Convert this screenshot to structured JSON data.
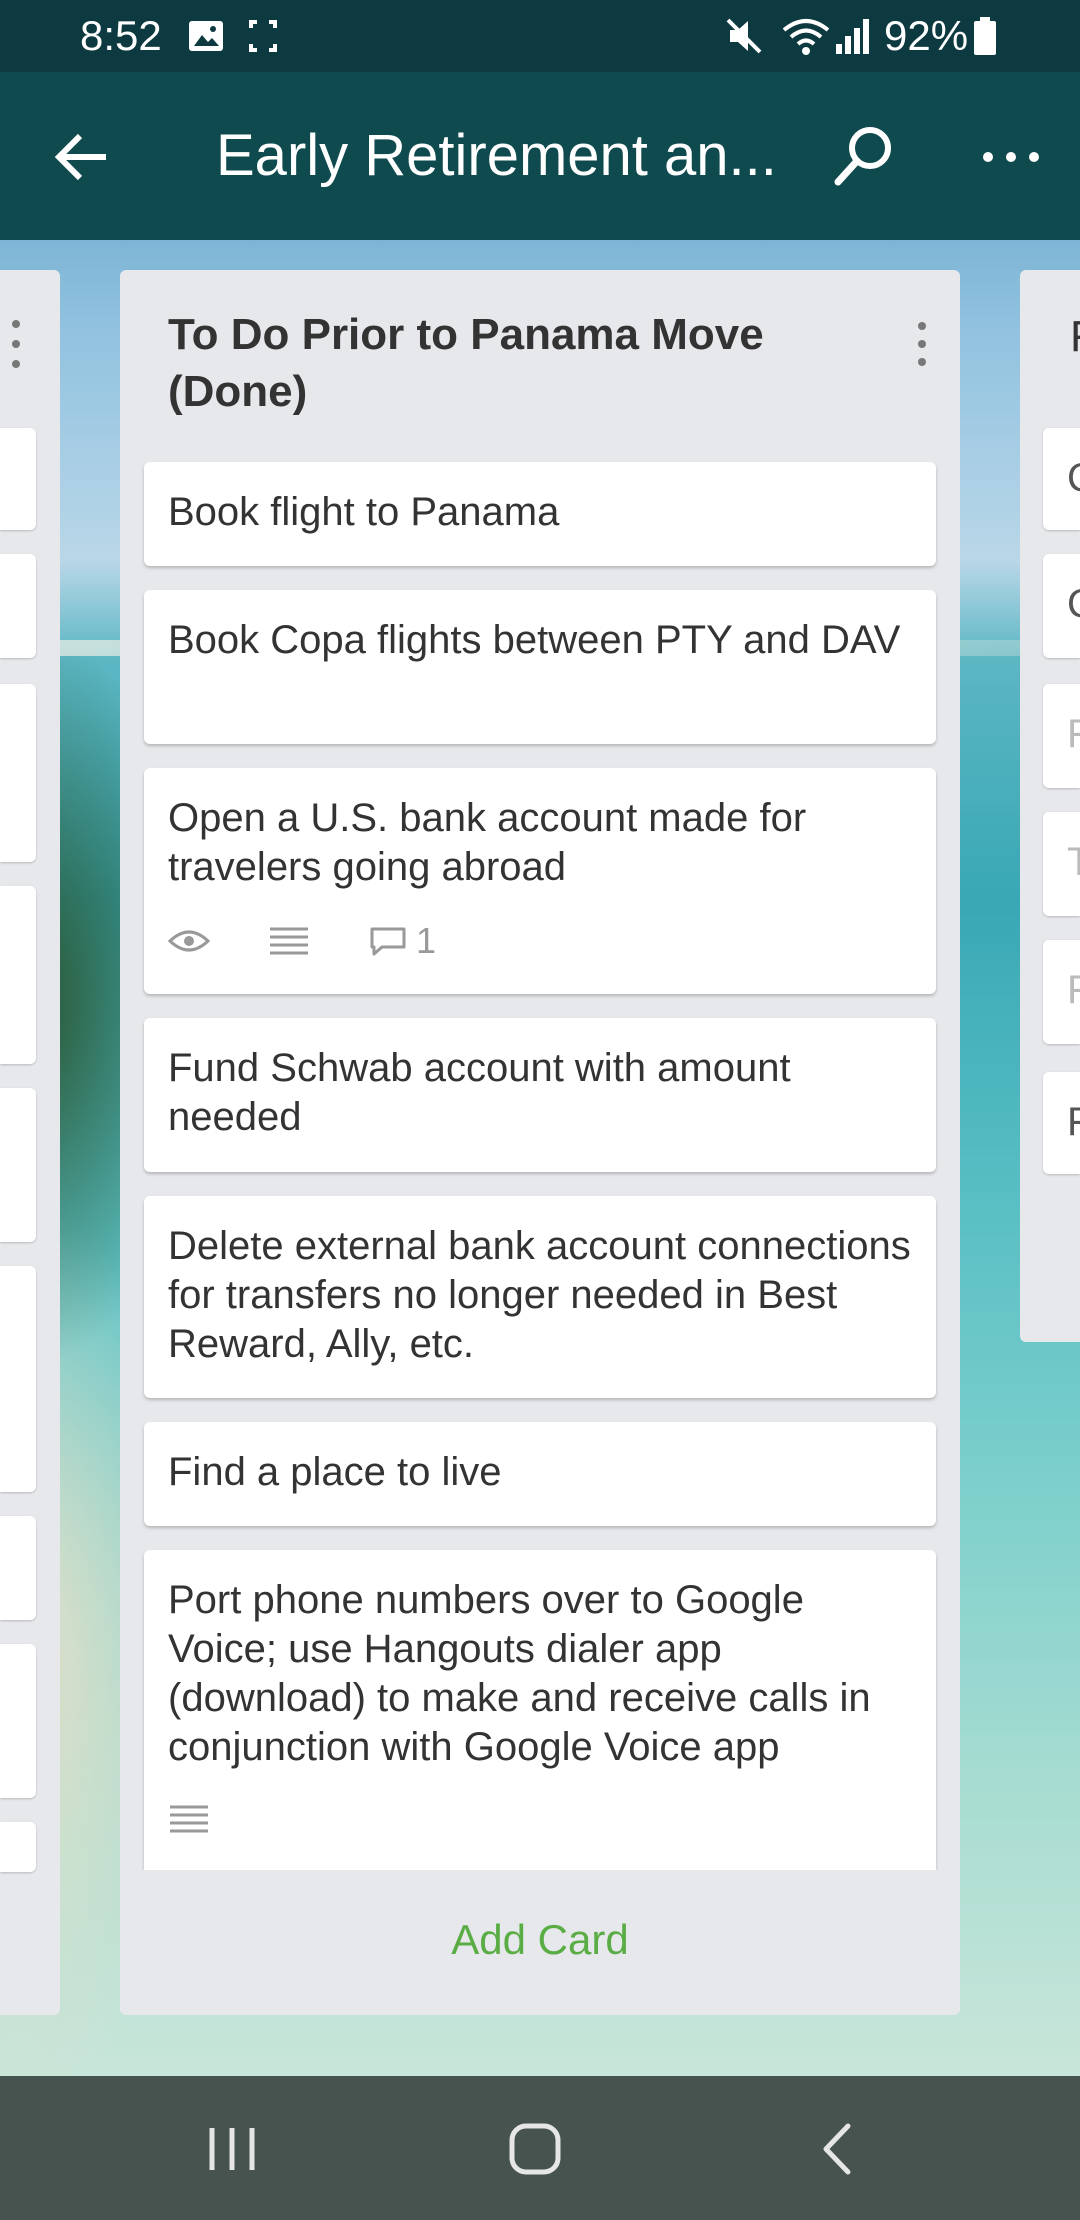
{
  "status_bar": {
    "time": "8:52",
    "battery": "92%",
    "icons": [
      "image-icon",
      "screenshot-icon",
      "mute-icon",
      "wifi-icon",
      "signal-icon",
      "battery-icon"
    ]
  },
  "app_bar": {
    "title": "Early Retirement an...",
    "icons": [
      "back-arrow-icon",
      "search-icon",
      "more-options-icon"
    ]
  },
  "left_list": {
    "icon": "vertical-dots-icon"
  },
  "right_list": {
    "title_fragment": "F",
    "card_fragments": [
      "C",
      "C",
      "F",
      "T",
      "F",
      "F"
    ]
  },
  "list": {
    "title": "To Do Prior to Panama Move (Done)",
    "cards": [
      {
        "text": "Book flight to Panama"
      },
      {
        "text": "Book Copa flights between PTY and DAV"
      },
      {
        "text": "Open a U.S. bank account made for travelers going abroad",
        "badges": {
          "watch": true,
          "description": true,
          "comments": "1"
        }
      },
      {
        "text": "Fund Schwab account with amount needed"
      },
      {
        "text": "Delete external bank account connections for transfers no longer needed in Best Reward, Ally, etc."
      },
      {
        "text": "Find a place to live"
      },
      {
        "text": "Port phone numbers over to Google Voice; use Hangouts dialer app (download) to make and receive calls in conjunction with Google Voice app",
        "badges": {
          "description": true
        }
      }
    ],
    "add_card_label": "Add Card"
  },
  "colors": {
    "status_bar": "#0d3a40",
    "app_bar": "#0f4a4f",
    "list_bg": "#e6e8eb",
    "add_card": "#5aac44"
  }
}
